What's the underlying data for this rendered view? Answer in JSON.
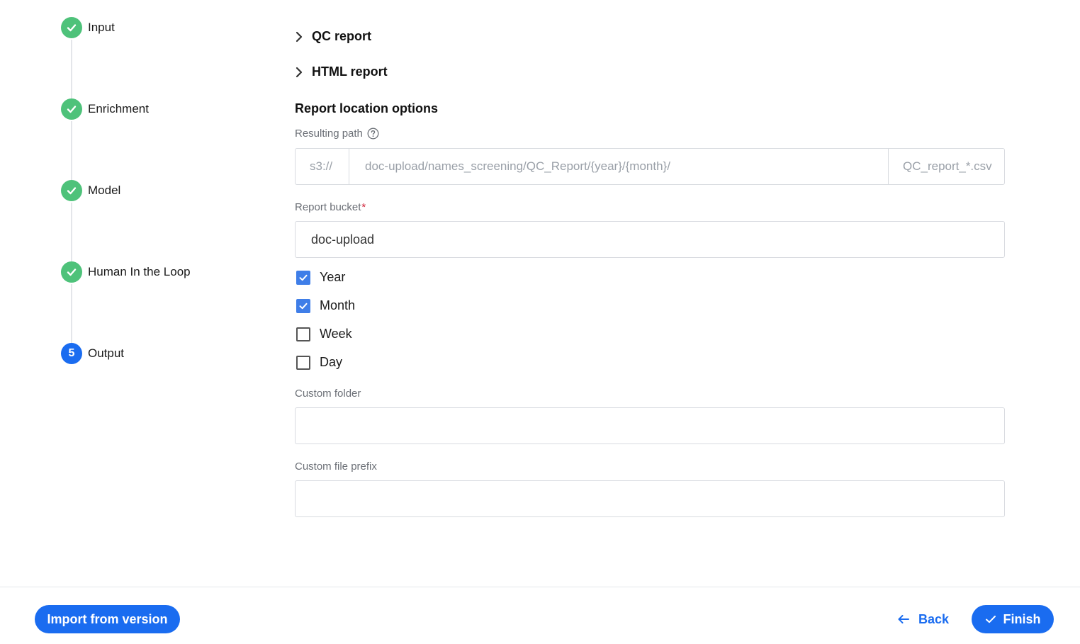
{
  "stepper": {
    "steps": [
      {
        "label": "Input",
        "status": "done"
      },
      {
        "label": "Enrichment",
        "status": "done"
      },
      {
        "label": "Model",
        "status": "done"
      },
      {
        "label": "Human In the Loop",
        "status": "done"
      },
      {
        "label": "Output",
        "status": "current",
        "number": "5"
      }
    ]
  },
  "sections": {
    "qc_report": "QC report",
    "html_report": "HTML report",
    "location_title": "Report location options"
  },
  "resulting_path": {
    "label": "Resulting path",
    "prefix": "s3://",
    "path": "doc-upload/names_screening/QC_Report/{year}/{month}/",
    "suffix": "QC_report_*.csv"
  },
  "report_bucket": {
    "label": "Report bucket",
    "required_mark": "*",
    "value": "doc-upload"
  },
  "checkboxes": [
    {
      "label": "Year",
      "checked": true
    },
    {
      "label": "Month",
      "checked": true
    },
    {
      "label": "Week",
      "checked": false
    },
    {
      "label": "Day",
      "checked": false
    }
  ],
  "custom_folder": {
    "label": "Custom folder",
    "value": ""
  },
  "custom_prefix": {
    "label": "Custom file prefix",
    "value": ""
  },
  "footer": {
    "import_label": "Import from version",
    "back_label": "Back",
    "finish_label": "Finish"
  },
  "colors": {
    "primary": "#1a6cf0",
    "success": "#4ec27a",
    "checkbox": "#3f7ee8",
    "required": "#d0253b"
  }
}
